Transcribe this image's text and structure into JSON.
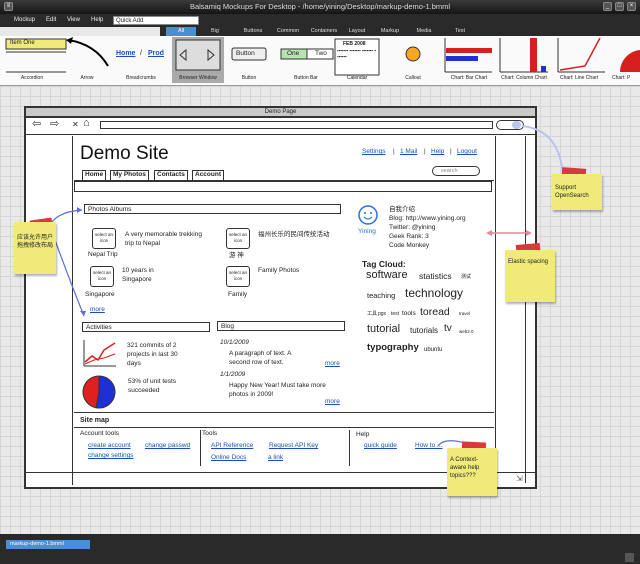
{
  "window": {
    "title": "Balsamiq Mockups For Desktop - /home/yining/Desktop/markup-demo-1.bmml"
  },
  "menu": {
    "items": [
      "Mockup",
      "Edit",
      "View",
      "Help"
    ],
    "quick_add_value": "Quick Add"
  },
  "categories": [
    "All",
    "Big",
    "Buttons",
    "Common",
    "Containers",
    "Layout",
    "Markup",
    "Media",
    "Text"
  ],
  "library": {
    "items": [
      "Accordion",
      "Arrow",
      "Breadcrumbs",
      "Browser Window",
      "Button",
      "Button Bar",
      "Calendar",
      "Callout",
      "Chart: Bar Chart",
      "Chart: Column Chart",
      "Chart: Line Chart",
      "Chart: P"
    ],
    "accordion_item": "Item One",
    "breadcrumbs": [
      "Home",
      "Prod"
    ],
    "button_label": "Button",
    "button_bar": [
      "One",
      "Two"
    ],
    "calendar_header": "FEB 2008"
  },
  "mockup": {
    "browser_title": "Demo Page",
    "site_title": "Demo Site",
    "top_links": [
      "Settings",
      "1 Mail",
      "Help",
      "Logout"
    ],
    "tabs": [
      "Home",
      "My Photos",
      "Contacts",
      "Account"
    ],
    "search_placeholder": "search",
    "photos_header": "Photos Albums",
    "icon_label": "select an icon",
    "albums": [
      {
        "name": "Nepal Trip",
        "desc": "A very memorable trekking trip to Nepal"
      },
      {
        "name": "游 神",
        "desc": "福州长乐的民间传统活动"
      },
      {
        "name": "Singapore",
        "desc": "10 years in Singapore"
      },
      {
        "name": "Family",
        "desc": "Family Photos"
      }
    ],
    "more": "more",
    "profile": {
      "name": "Yining",
      "lines": [
        "自我介绍",
        "Blog: http://www.yining.org",
        "Twitter: @yining",
        "Geek Rank: 3",
        "Code Monkey"
      ]
    },
    "tag_cloud_title": "Tag Cloud:",
    "tags": [
      "software",
      "statistics",
      "测试",
      "teaching",
      "technology",
      "工具",
      "pgx",
      "test",
      "tools",
      "toread",
      "travel",
      "tutorial",
      "tutorials",
      "tv",
      "web2.0",
      "typography",
      "ubuntu"
    ],
    "activities_header": "Activities",
    "activities": [
      "321 commits of 2 projects in last 30 days",
      "53% of unit tests succeeded"
    ],
    "pie_chart_data": {
      "type": "pie",
      "values": [
        53,
        47
      ],
      "colors": [
        "#1e2fd6",
        "#e02020"
      ]
    },
    "blog_header": "Blog",
    "blog": [
      {
        "date": "10/1/2009",
        "text": "A paragraph of text. A second row of text."
      },
      {
        "date": "1/1/2009",
        "text": "Happy New Year! Must take more photos in 2009!"
      }
    ],
    "sitemap_title": "Site map",
    "sitemap": {
      "account_title": "Account tools",
      "account_links": [
        "create account",
        "change passwd",
        "change settings"
      ],
      "tools_title": "Tools",
      "tools_links": [
        "API Reference",
        "Request API Key",
        "Online Docs",
        "a link"
      ],
      "help_title": "Help",
      "help_links": [
        "quick guide",
        "How to ..."
      ]
    }
  },
  "notes": {
    "chinese": "应该允许用户拖拽修改布局",
    "opensearch": "Support OpenSearch",
    "elastic": "Elastic spacing",
    "context_help": "A Context-aware help topics???"
  },
  "status": {
    "file_tab": "markup-demo-1.bmml"
  },
  "colors": {
    "link": "#1a4dbf",
    "sticky": "#f0eb78",
    "tape": "#d63a3a",
    "select": "#4a8fd6"
  }
}
